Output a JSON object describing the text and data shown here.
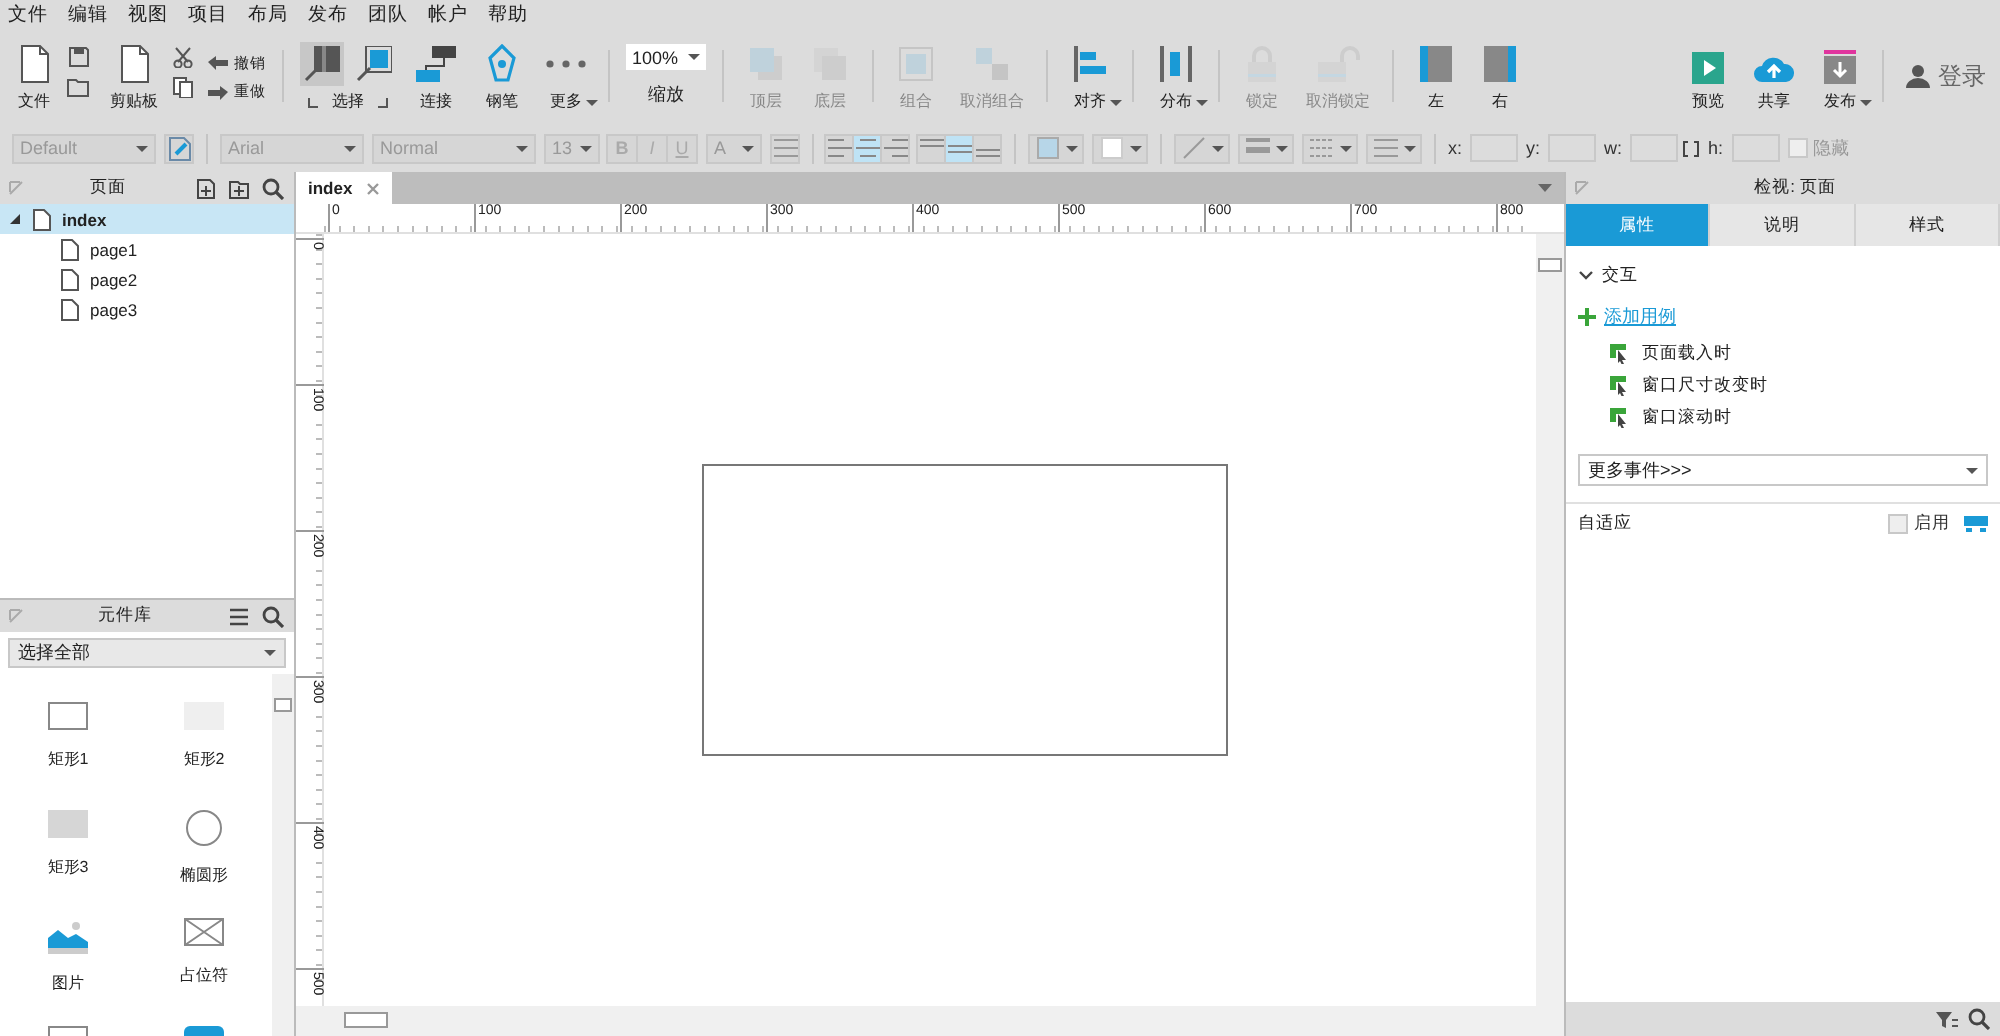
{
  "menu": [
    "文件",
    "编辑",
    "视图",
    "项目",
    "布局",
    "发布",
    "团队",
    "帐户",
    "帮助"
  ],
  "toolbar": {
    "sections": [
      [
        {
          "kind": "file",
          "label": "文件",
          "disabled": false
        },
        {
          "kind": "clipboard",
          "label": "剪贴板",
          "disabled": false
        },
        {
          "kind": "history",
          "items": [
            "撤销",
            "重做"
          ],
          "disabled": false
        }
      ],
      [
        {
          "kind": "select",
          "label": "选择",
          "disabled": false,
          "modes": [
            {
              "selected": true
            },
            {
              "selected": false
            }
          ]
        },
        {
          "kind": "connect",
          "label": "连接",
          "disabled": false
        },
        {
          "kind": "pen",
          "label": "钢笔",
          "disabled": false
        },
        {
          "kind": "more",
          "label": "更多",
          "dropdown": true,
          "disabled": false
        }
      ],
      [
        {
          "kind": "zoom",
          "label": "缩放",
          "value": "100%",
          "disabled": false
        }
      ],
      [
        {
          "kind": "front",
          "label": "顶层",
          "disabled": true
        },
        {
          "kind": "back",
          "label": "底层",
          "disabled": true
        }
      ],
      [
        {
          "kind": "group",
          "label": "组合",
          "disabled": true
        },
        {
          "kind": "ungroup",
          "label": "取消组合",
          "disabled": true
        }
      ],
      [
        {
          "kind": "align",
          "label": "对齐",
          "dropdown": true,
          "disabled": false
        }
      ],
      [
        {
          "kind": "distribute",
          "label": "分布",
          "dropdown": true,
          "disabled": false
        }
      ],
      [
        {
          "kind": "lock",
          "label": "锁定",
          "disabled": true
        },
        {
          "kind": "unlock",
          "label": "取消锁定",
          "disabled": true
        }
      ],
      [
        {
          "kind": "left",
          "label": "左",
          "disabled": false
        },
        {
          "kind": "right",
          "label": "右",
          "disabled": false
        }
      ]
    ],
    "right_sections": [
      [
        {
          "kind": "preview",
          "label": "预览",
          "disabled": false
        },
        {
          "kind": "share",
          "label": "共享",
          "disabled": false
        },
        {
          "kind": "publish",
          "label": "发布",
          "dropdown": true,
          "disabled": false
        }
      ],
      [
        {
          "kind": "login",
          "label": "登录",
          "disabled": false
        }
      ]
    ]
  },
  "format_bar": {
    "style": "Default",
    "font": "Arial",
    "weight": "Normal",
    "size": "13",
    "text_styles": [
      "B",
      "I",
      "U"
    ],
    "font_color": "A",
    "h_align": [
      {
        "selected": false
      },
      {
        "selected": true
      },
      {
        "selected": false
      }
    ],
    "v_align": [
      {
        "selected": false
      },
      {
        "selected": true
      },
      {
        "selected": false
      }
    ],
    "geometry": [
      {
        "label": "x:"
      },
      {
        "label": "y:"
      },
      {
        "label": "w:"
      },
      {
        "label": "h:"
      }
    ],
    "hidden": {
      "label": "隐藏",
      "checked": false
    }
  },
  "pages": {
    "title": "页面",
    "tree": [
      {
        "label": "index",
        "selected": true,
        "expanded": true,
        "children": [
          {
            "label": "page1",
            "selected": false
          },
          {
            "label": "page2",
            "selected": false
          },
          {
            "label": "page3",
            "selected": false
          }
        ]
      }
    ]
  },
  "library": {
    "title": "元件库",
    "filter": "选择全部",
    "items": [
      {
        "kind": "rect-outline",
        "label": "矩形1"
      },
      {
        "kind": "rect-light",
        "label": "矩形2"
      },
      {
        "kind": "rect-grey",
        "label": "矩形3"
      },
      {
        "kind": "ellipse",
        "label": "椭圆形"
      },
      {
        "kind": "image",
        "label": "图片"
      },
      {
        "kind": "placeholder",
        "label": "占位符"
      },
      {
        "kind": "rect-outline"
      },
      {
        "kind": "button-blue"
      }
    ]
  },
  "canvas": {
    "tabs": [
      {
        "label": "index",
        "selected": true
      }
    ],
    "h_ruler": [
      "0",
      "100",
      "200",
      "300",
      "400",
      "500",
      "600",
      "700",
      "800"
    ],
    "v_ruler": [
      "0",
      "100",
      "200",
      "300",
      "400",
      "500"
    ],
    "widgets": [
      {
        "kind": "rectangle"
      }
    ]
  },
  "inspector": {
    "title": "检视: 页面",
    "tabs": [
      {
        "label": "属性",
        "selected": true
      },
      {
        "label": "说明",
        "selected": false
      },
      {
        "label": "样式",
        "selected": false
      }
    ],
    "section": {
      "label": "交互",
      "expanded": true
    },
    "add_case": "添加用例",
    "events": [
      "页面载入时",
      "窗口尺寸改变时",
      "窗口滚动时"
    ],
    "more_events": "更多事件>>>",
    "adaptive": {
      "label": "自适应",
      "toggle": {
        "label": "启用",
        "checked": false
      }
    }
  }
}
